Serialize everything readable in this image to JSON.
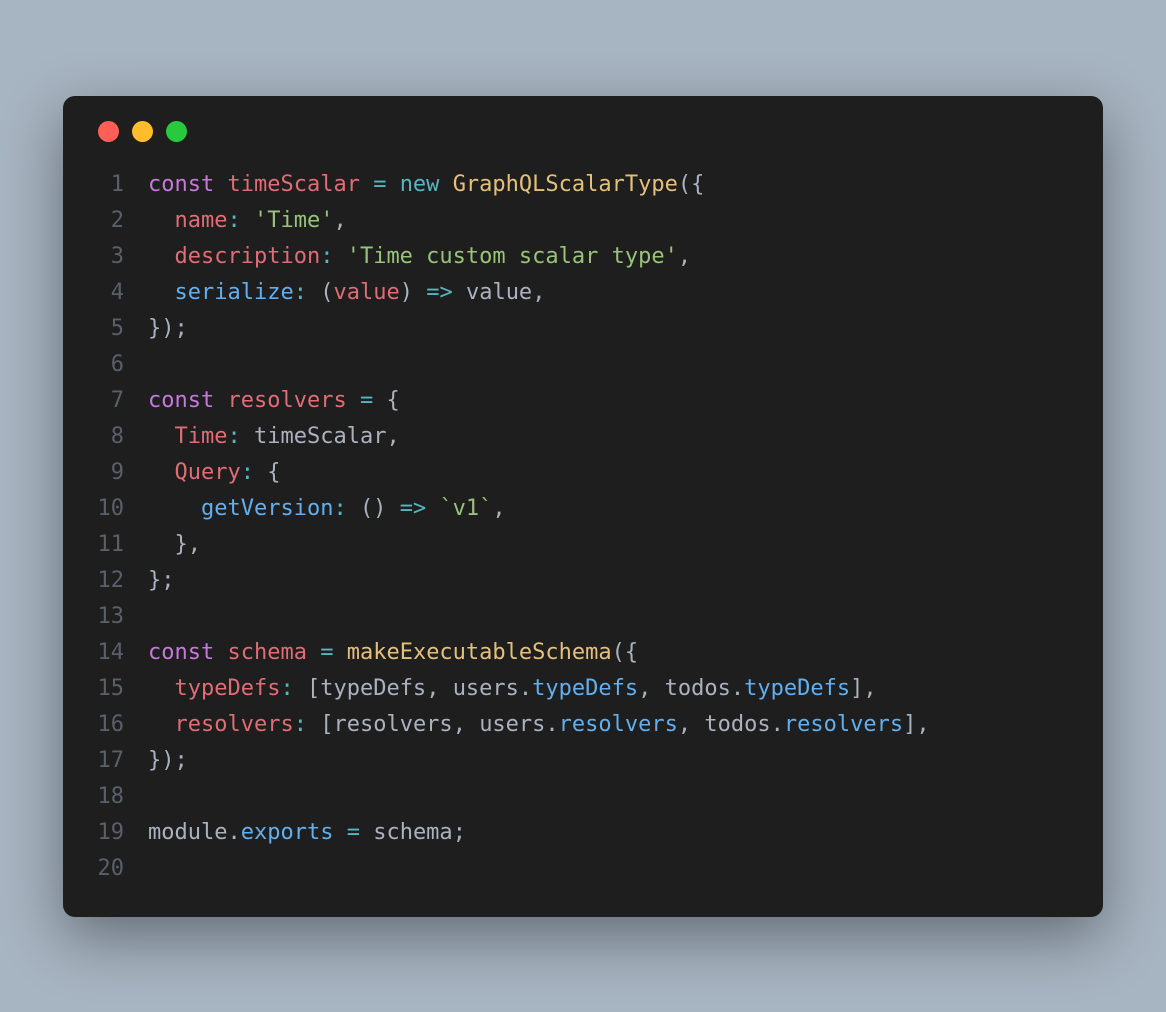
{
  "titlebar": {
    "close": "close",
    "minimize": "minimize",
    "maximize": "maximize"
  },
  "code": {
    "lines": [
      {
        "n": "1",
        "tokens": [
          [
            "kw",
            "const"
          ],
          [
            "plain",
            " "
          ],
          [
            "var",
            "timeScalar"
          ],
          [
            "plain",
            " "
          ],
          [
            "op",
            "="
          ],
          [
            "plain",
            " "
          ],
          [
            "op",
            "new"
          ],
          [
            "plain",
            " "
          ],
          [
            "fn",
            "GraphQLScalarType"
          ],
          [
            "punct",
            "({"
          ]
        ]
      },
      {
        "n": "2",
        "tokens": [
          [
            "plain",
            "  "
          ],
          [
            "var",
            "name"
          ],
          [
            "op",
            ":"
          ],
          [
            "plain",
            " "
          ],
          [
            "str",
            "'Time'"
          ],
          [
            "punct",
            ","
          ]
        ]
      },
      {
        "n": "3",
        "tokens": [
          [
            "plain",
            "  "
          ],
          [
            "var",
            "description"
          ],
          [
            "op",
            ":"
          ],
          [
            "plain",
            " "
          ],
          [
            "str",
            "'Time custom scalar type'"
          ],
          [
            "punct",
            ","
          ]
        ]
      },
      {
        "n": "4",
        "tokens": [
          [
            "plain",
            "  "
          ],
          [
            "prop",
            "serialize"
          ],
          [
            "op",
            ":"
          ],
          [
            "plain",
            " "
          ],
          [
            "punct",
            "("
          ],
          [
            "var",
            "value"
          ],
          [
            "punct",
            ")"
          ],
          [
            "plain",
            " "
          ],
          [
            "op",
            "=>"
          ],
          [
            "plain",
            " "
          ],
          [
            "ident",
            "value"
          ],
          [
            "punct",
            ","
          ]
        ]
      },
      {
        "n": "5",
        "tokens": [
          [
            "punct",
            "});"
          ]
        ]
      },
      {
        "n": "6",
        "tokens": [
          [
            "plain",
            ""
          ]
        ]
      },
      {
        "n": "7",
        "tokens": [
          [
            "kw",
            "const"
          ],
          [
            "plain",
            " "
          ],
          [
            "var",
            "resolvers"
          ],
          [
            "plain",
            " "
          ],
          [
            "op",
            "="
          ],
          [
            "plain",
            " "
          ],
          [
            "punct",
            "{"
          ]
        ]
      },
      {
        "n": "8",
        "tokens": [
          [
            "plain",
            "  "
          ],
          [
            "var",
            "Time"
          ],
          [
            "op",
            ":"
          ],
          [
            "plain",
            " "
          ],
          [
            "ident",
            "timeScalar"
          ],
          [
            "punct",
            ","
          ]
        ]
      },
      {
        "n": "9",
        "tokens": [
          [
            "plain",
            "  "
          ],
          [
            "var",
            "Query"
          ],
          [
            "op",
            ":"
          ],
          [
            "plain",
            " "
          ],
          [
            "punct",
            "{"
          ]
        ]
      },
      {
        "n": "10",
        "tokens": [
          [
            "plain",
            "    "
          ],
          [
            "prop",
            "getVersion"
          ],
          [
            "op",
            ":"
          ],
          [
            "plain",
            " "
          ],
          [
            "punct",
            "()"
          ],
          [
            "plain",
            " "
          ],
          [
            "op",
            "=>"
          ],
          [
            "plain",
            " "
          ],
          [
            "str",
            "`v1`"
          ],
          [
            "punct",
            ","
          ]
        ]
      },
      {
        "n": "11",
        "tokens": [
          [
            "plain",
            "  "
          ],
          [
            "punct",
            "},"
          ]
        ]
      },
      {
        "n": "12",
        "tokens": [
          [
            "punct",
            "};"
          ]
        ]
      },
      {
        "n": "13",
        "tokens": [
          [
            "plain",
            ""
          ]
        ]
      },
      {
        "n": "14",
        "tokens": [
          [
            "kw",
            "const"
          ],
          [
            "plain",
            " "
          ],
          [
            "var",
            "schema"
          ],
          [
            "plain",
            " "
          ],
          [
            "op",
            "="
          ],
          [
            "plain",
            " "
          ],
          [
            "fn",
            "makeExecutableSchema"
          ],
          [
            "punct",
            "({"
          ]
        ]
      },
      {
        "n": "15",
        "tokens": [
          [
            "plain",
            "  "
          ],
          [
            "var",
            "typeDefs"
          ],
          [
            "op",
            ":"
          ],
          [
            "plain",
            " "
          ],
          [
            "punct",
            "["
          ],
          [
            "ident",
            "typeDefs"
          ],
          [
            "punct",
            ", "
          ],
          [
            "ident",
            "users"
          ],
          [
            "punct",
            "."
          ],
          [
            "prop",
            "typeDefs"
          ],
          [
            "punct",
            ", "
          ],
          [
            "ident",
            "todos"
          ],
          [
            "punct",
            "."
          ],
          [
            "prop",
            "typeDefs"
          ],
          [
            "punct",
            "],"
          ]
        ]
      },
      {
        "n": "16",
        "tokens": [
          [
            "plain",
            "  "
          ],
          [
            "var",
            "resolvers"
          ],
          [
            "op",
            ":"
          ],
          [
            "plain",
            " "
          ],
          [
            "punct",
            "["
          ],
          [
            "ident",
            "resolvers"
          ],
          [
            "punct",
            ", "
          ],
          [
            "ident",
            "users"
          ],
          [
            "punct",
            "."
          ],
          [
            "prop",
            "resolvers"
          ],
          [
            "punct",
            ", "
          ],
          [
            "ident",
            "todos"
          ],
          [
            "punct",
            "."
          ],
          [
            "prop",
            "resolvers"
          ],
          [
            "punct",
            "],"
          ]
        ]
      },
      {
        "n": "17",
        "tokens": [
          [
            "punct",
            "});"
          ]
        ]
      },
      {
        "n": "18",
        "tokens": [
          [
            "plain",
            ""
          ]
        ]
      },
      {
        "n": "19",
        "tokens": [
          [
            "ident",
            "module"
          ],
          [
            "punct",
            "."
          ],
          [
            "prop",
            "exports"
          ],
          [
            "plain",
            " "
          ],
          [
            "op",
            "="
          ],
          [
            "plain",
            " "
          ],
          [
            "ident",
            "schema"
          ],
          [
            "punct",
            ";"
          ]
        ]
      },
      {
        "n": "20",
        "tokens": [
          [
            "plain",
            ""
          ]
        ]
      }
    ]
  }
}
